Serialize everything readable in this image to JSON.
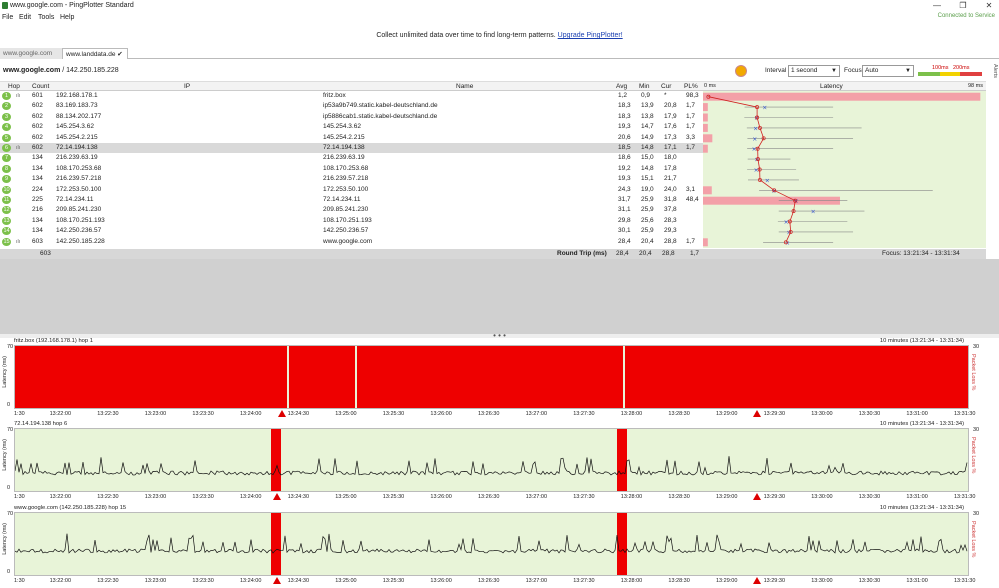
{
  "window": {
    "title": "www.google.com - PingPlotter Standard",
    "minimize": "—",
    "maximize": "❐",
    "close": "✕"
  },
  "menu": [
    "File",
    "Edit",
    "Tools",
    "Help"
  ],
  "connection_status": "Connected to Service",
  "banner": {
    "text": "Collect unlimited data over time to find long-term patterns.",
    "link": "Upgrade PingPlotter!"
  },
  "tabs": [
    {
      "label": "www.google.com"
    },
    {
      "label": "www.landdata.de ✔"
    }
  ],
  "target": {
    "host": "www.google.com",
    "ip": " / 142.250.185.228"
  },
  "controls": {
    "interval_label": "Interval",
    "interval_value": "1 second",
    "focus_label": "Focus",
    "focus_value": "Auto",
    "scale_100": "100ms",
    "scale_200": "200ms",
    "alerts": "Alerts"
  },
  "table": {
    "headers": {
      "hop": "Hop",
      "count": "Count",
      "ip": "IP",
      "name": "Name",
      "avg": "Avg",
      "min": "Min",
      "cur": "Cur",
      "pl": "PL%",
      "latency": "Latency",
      "lat_min": "0 ms",
      "lat_max": "98 ms"
    },
    "rows": [
      {
        "hop": "1",
        "count": "601",
        "ip": "192.168.178.1",
        "name": "fritz.box",
        "avg": "1,2",
        "min": "0,9",
        "cur": "*",
        "pl": "98,3",
        "lossw": 0.98,
        "a": 1.2,
        "mn": 0.9,
        "mx": 1.5,
        "cr": null
      },
      {
        "hop": "2",
        "count": "602",
        "ip": "83.169.183.73",
        "name": "ip53a9b749.static.kabel-deutschland.de",
        "avg": "18,3",
        "min": "13,9",
        "cur": "20,8",
        "pl": "1,7",
        "lossw": 0.017,
        "a": 18.3,
        "mn": 13.9,
        "mx": 45,
        "cr": 20.8
      },
      {
        "hop": "3",
        "count": "602",
        "ip": "88.134.202.177",
        "name": "ip5886cab1.static.kabel-deutschland.de",
        "avg": "18,3",
        "min": "13,8",
        "cur": "17,9",
        "pl": "1,7",
        "lossw": 0.017,
        "a": 18.3,
        "mn": 13.8,
        "mx": 45,
        "cr": 17.9
      },
      {
        "hop": "4",
        "count": "602",
        "ip": "145.254.3.62",
        "name": "145.254.3.62",
        "avg": "19,3",
        "min": "14,7",
        "cur": "17,6",
        "pl": "1,7",
        "lossw": 0.017,
        "a": 19.3,
        "mn": 14.7,
        "mx": 55,
        "cr": 17.6
      },
      {
        "hop": "5",
        "count": "602",
        "ip": "145.254.2.215",
        "name": "145.254.2.215",
        "avg": "20,6",
        "min": "14,9",
        "cur": "17,3",
        "pl": "3,3",
        "lossw": 0.033,
        "a": 20.6,
        "mn": 14.9,
        "mx": 52,
        "cr": 17.3
      },
      {
        "hop": "6",
        "count": "602",
        "ip": "72.14.194.138",
        "name": "72.14.194.138",
        "avg": "18,5",
        "min": "14,8",
        "cur": "17,1",
        "pl": "1,7",
        "lossw": 0.017,
        "a": 18.5,
        "mn": 14.8,
        "mx": 45,
        "cr": 17.1,
        "sel": true
      },
      {
        "hop": "7",
        "count": "134",
        "ip": "216.239.63.19",
        "name": "216.239.63.19",
        "avg": "18,6",
        "min": "15,0",
        "cur": "18,0",
        "pl": "",
        "lossw": 0,
        "a": 18.6,
        "mn": 15.0,
        "mx": 30,
        "cr": 18.0
      },
      {
        "hop": "8",
        "count": "134",
        "ip": "108.170.253.68",
        "name": "108.170.253.68",
        "avg": "19,2",
        "min": "14,8",
        "cur": "17,8",
        "pl": "",
        "lossw": 0,
        "a": 19.2,
        "mn": 14.8,
        "mx": 32,
        "cr": 17.8
      },
      {
        "hop": "9",
        "count": "134",
        "ip": "216.239.57.218",
        "name": "216.239.57.218",
        "avg": "19,3",
        "min": "15,1",
        "cur": "21,7",
        "pl": "",
        "lossw": 0,
        "a": 19.3,
        "mn": 15.1,
        "mx": 33,
        "cr": 21.7
      },
      {
        "hop": "10",
        "count": "224",
        "ip": "172.253.50.100",
        "name": "172.253.50.100",
        "avg": "24,3",
        "min": "19,0",
        "cur": "24,0",
        "pl": "3,1",
        "lossw": 0.031,
        "a": 24.3,
        "mn": 19.0,
        "mx": 80,
        "cr": 24.0
      },
      {
        "hop": "11",
        "count": "225",
        "ip": "72.14.234.11",
        "name": "72.14.234.11",
        "avg": "31,7",
        "min": "25,9",
        "cur": "31,8",
        "pl": "48,4",
        "lossw": 0.484,
        "a": 31.7,
        "mn": 25.9,
        "mx": 50,
        "cr": 31.8
      },
      {
        "hop": "12",
        "count": "216",
        "ip": "209.85.241.230",
        "name": "209.85.241.230",
        "avg": "31,1",
        "min": "25,9",
        "cur": "37,8",
        "pl": "",
        "lossw": 0,
        "a": 31.1,
        "mn": 25.9,
        "mx": 56,
        "cr": 37.8
      },
      {
        "hop": "13",
        "count": "134",
        "ip": "108.170.251.193",
        "name": "108.170.251.193",
        "avg": "29,8",
        "min": "25,6",
        "cur": "28,3",
        "pl": "",
        "lossw": 0,
        "a": 29.8,
        "mn": 25.6,
        "mx": 50,
        "cr": 28.3
      },
      {
        "hop": "14",
        "count": "134",
        "ip": "142.250.236.57",
        "name": "142.250.236.57",
        "avg": "30,1",
        "min": "25,9",
        "cur": "29,3",
        "pl": "",
        "lossw": 0,
        "a": 30.1,
        "mn": 25.9,
        "mx": 52,
        "cr": 29.3
      },
      {
        "hop": "15",
        "count": "603",
        "ip": "142.250.185.228",
        "name": "www.google.com",
        "avg": "28,4",
        "min": "20,4",
        "cur": "28,8",
        "pl": "1,7",
        "lossw": 0.017,
        "a": 28.4,
        "mn": 20.4,
        "mx": 45,
        "cr": 28.8
      }
    ],
    "footer": {
      "count": "603",
      "label": "Round Trip (ms)",
      "avg": "28,4",
      "min": "20,4",
      "cur": "28,8",
      "pl": "1,7",
      "focus": "Focus: 13:21:34 - 13:31:34"
    }
  },
  "graphs": [
    {
      "title": "fritz.box (192.168.178.1) hop 1",
      "range": "10 minutes (13:21:34 - 13:31:34)",
      "ylabel": "Latency (ms)",
      "rlabel": "Packet Loss %",
      "ymax": "70",
      "ymin": "0",
      "rmax": "30",
      "loss_mode": "full",
      "gaps": [
        0.285,
        0.357,
        0.638
      ],
      "markers": [
        0.281,
        0.78
      ],
      "type": "loss"
    },
    {
      "title": "72.14.194.138 hop 6",
      "range": "10 minutes (13:21:34 - 13:31:34)",
      "ylabel": "Latency (ms)",
      "rlabel": "Packet Loss %",
      "ymax": "70",
      "ymin": "0",
      "rmax": "30",
      "lossbars": [
        0.269,
        0.632
      ],
      "markers": [
        0.276,
        0.78
      ],
      "type": "latency"
    },
    {
      "title": "www.google.com (142.250.185.228) hop 15",
      "range": "10 minutes (13:21:34 - 13:31:34)",
      "ylabel": "Latency (ms)",
      "rlabel": "Packet Loss %",
      "ymax": "70",
      "ymin": "0",
      "rmax": "30",
      "lossbars": [
        0.269,
        0.632
      ],
      "markers": [
        0.276,
        0.78
      ],
      "type": "latency"
    }
  ],
  "xticks": [
    "1:30",
    "13:22:00",
    "13:22:30",
    "13:23:00",
    "13:23:30",
    "13:24:00",
    "13:24:30",
    "13:25:00",
    "13:25:30",
    "13:26:00",
    "13:26:30",
    "13:27:00",
    "13:27:30",
    "13:28:00",
    "13:28:30",
    "13:29:00",
    "13:29:30",
    "13:30:00",
    "13:30:30",
    "13:31:00",
    "13:31:30"
  ],
  "colors": {
    "green": "#7cc04a",
    "loss": "#ee0000",
    "bg": "#e8f4d8"
  }
}
